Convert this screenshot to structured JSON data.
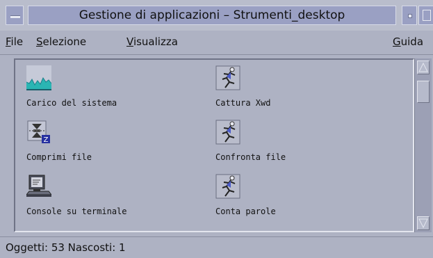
{
  "window": {
    "title": "Gestione di applicazioni – Strumenti_desktop"
  },
  "menu": {
    "file": {
      "first": "F",
      "rest": "ile"
    },
    "selezione": {
      "first": "S",
      "rest": "elezione"
    },
    "visualizza": {
      "first": "V",
      "rest": "isualizza"
    },
    "guida": {
      "first": "G",
      "rest": "uida"
    }
  },
  "items": [
    {
      "label": "Carico del sistema",
      "icon": "system-load-icon"
    },
    {
      "label": "Cattura Xwd",
      "icon": "running-man-icon"
    },
    {
      "label": "Comprimi file",
      "icon": "compress-file-icon"
    },
    {
      "label": "Confronta file",
      "icon": "running-man-icon"
    },
    {
      "label": "Console su terminale",
      "icon": "terminal-console-icon"
    },
    {
      "label": "Conta parole",
      "icon": "running-man-icon"
    }
  ],
  "status": {
    "text": "Oggetti: 53 Nascosti: 1"
  },
  "colors": {
    "window_bg": "#aeb2c3",
    "titlebar": "#9aa0c3"
  }
}
